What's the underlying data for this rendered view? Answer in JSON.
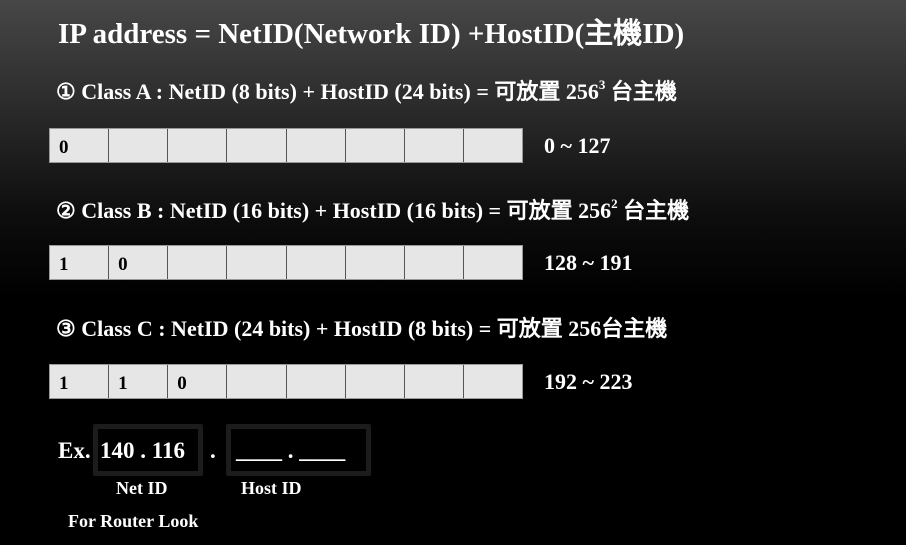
{
  "title": "IP address = NetID(Network ID) +HostID(主機ID)",
  "classes": [
    {
      "label": "① Class A : NetID (8 bits) + HostID (24 bits) = 可放置 256",
      "exp": "3",
      "suffix": " 台主機",
      "bits": [
        "0",
        "",
        "",
        "",
        "",
        "",
        "",
        ""
      ],
      "range": "0 ~ 127"
    },
    {
      "label": "② Class B : NetID (16 bits) + HostID (16 bits) = 可放置 256",
      "exp": "2",
      "suffix": " 台主機",
      "bits": [
        "1",
        "0",
        "",
        "",
        "",
        "",
        "",
        ""
      ],
      "range": "128 ~ 191"
    },
    {
      "label": "③ Class C : NetID (24 bits) + HostID (8 bits) = 可放置 256台主機",
      "exp": "",
      "suffix": "",
      "bits": [
        "1",
        "1",
        "0",
        "",
        "",
        "",
        "",
        ""
      ],
      "range": "192 ~ 223"
    }
  ],
  "example": {
    "prefix": "Ex.",
    "net": "140 . 116",
    "dot": ".",
    "host": "____ . ____",
    "net_label": "Net ID",
    "host_label": "Host ID",
    "note": "For Router Look"
  }
}
